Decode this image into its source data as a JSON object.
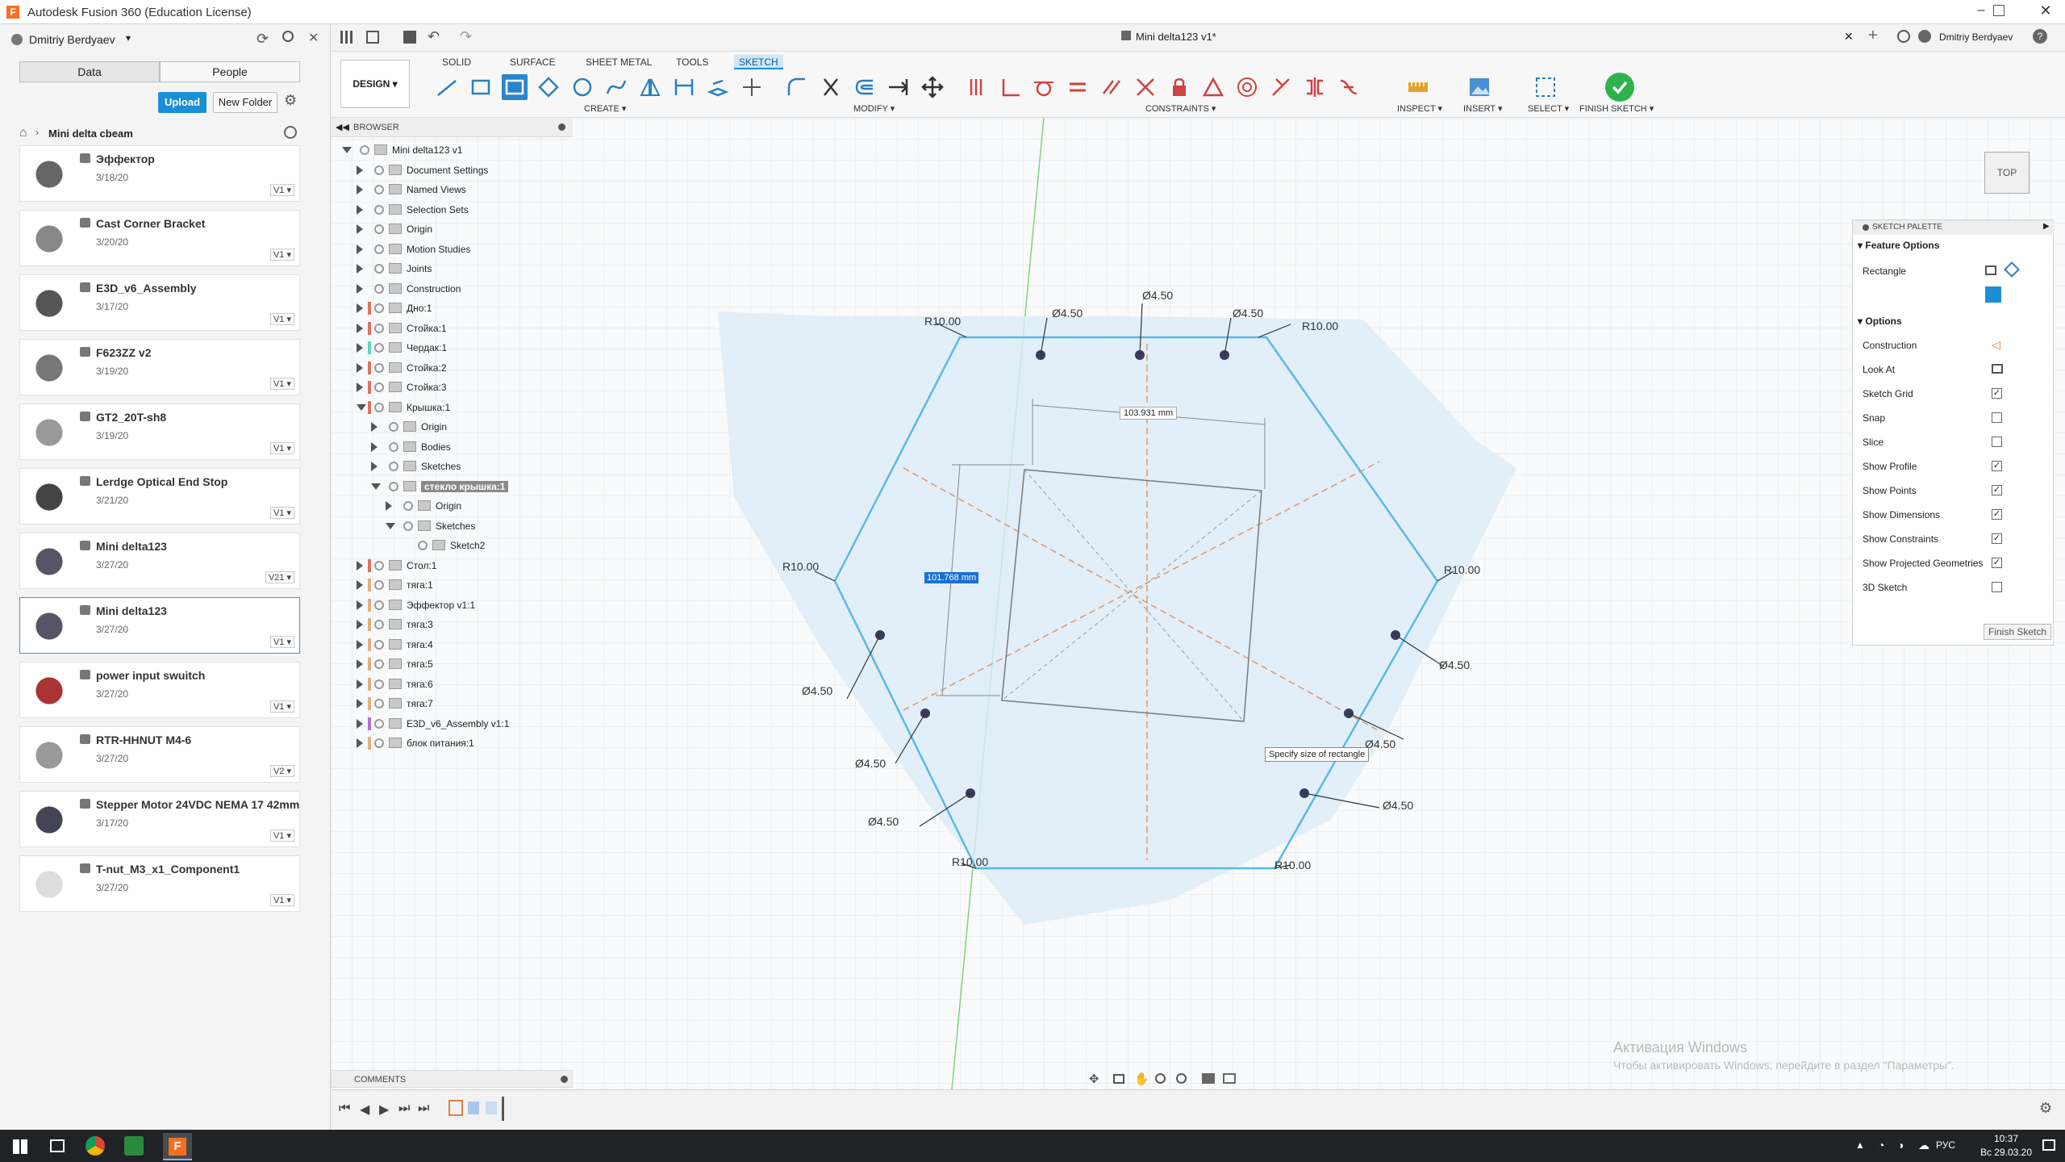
{
  "window": {
    "title": "Autodesk Fusion 360 (Education License)",
    "doc_title": "Mini delta123 v1*",
    "user": "Dmitriy Berdyaev"
  },
  "left": {
    "user": "Dmitriy Berdyaev",
    "tabs": [
      "Data",
      "People"
    ],
    "upload": "Upload",
    "new_folder": "New Folder",
    "project": "Mini delta cbeam",
    "files": [
      {
        "name": "Эффектор",
        "date": "3/18/20",
        "ver": "V1"
      },
      {
        "name": "Cast Corner Bracket",
        "date": "3/20/20",
        "ver": "V1"
      },
      {
        "name": "E3D_v6_Assembly",
        "date": "3/17/20",
        "ver": "V1"
      },
      {
        "name": "F623ZZ v2",
        "date": "3/19/20",
        "ver": "V1"
      },
      {
        "name": "GT2_20T-sh8",
        "date": "3/19/20",
        "ver": "V1"
      },
      {
        "name": "Lerdge Optical End Stop",
        "date": "3/21/20",
        "ver": "V1"
      },
      {
        "name": "Mini delta123",
        "date": "3/27/20",
        "ver": "V21"
      },
      {
        "name": "Mini delta123",
        "date": "3/27/20",
        "ver": "V1"
      },
      {
        "name": "power input swuitch",
        "date": "3/27/20",
        "ver": "V1"
      },
      {
        "name": "RTR-HHNUT M4-6",
        "date": "3/27/20",
        "ver": "V2"
      },
      {
        "name": "Stepper Motor 24VDC NEMA 17 42mm",
        "date": "3/17/20",
        "ver": "V1"
      },
      {
        "name": "T-nut_M3_x1_Component1",
        "date": "3/27/20",
        "ver": "V1"
      }
    ]
  },
  "toolbar": {
    "workspace": "DESIGN",
    "tabs": [
      "SOLID",
      "SURFACE",
      "SHEET METAL",
      "TOOLS",
      "SKETCH"
    ],
    "groups": {
      "create": "CREATE",
      "modify": "MODIFY",
      "constraints": "CONSTRAINTS",
      "inspect": "INSPECT",
      "insert": "INSERT",
      "select": "SELECT",
      "finish": "FINISH SKETCH"
    }
  },
  "browser": {
    "title": "BROWSER",
    "comments": "COMMENTS",
    "items": [
      "Mini delta123 v1",
      "Document Settings",
      "Named Views",
      "Selection Sets",
      "Origin",
      "Motion Studies",
      "Joints",
      "Construction",
      "Дно:1",
      "Стойка:1",
      "Чердак:1",
      "Стойка:2",
      "Стойка:3",
      "Крышка:1",
      "Origin",
      "Bodies",
      "Sketches",
      "стекло крышка:1",
      "Origin",
      "Sketches",
      "Sketch2",
      "Стол:1",
      "тяга:1",
      "Эффектор v1:1",
      "тяга:3",
      "тяга:4",
      "тяга:5",
      "тяга:6",
      "тяга:7",
      "E3D_v6_Assembly v1:1",
      "блок питания:1"
    ]
  },
  "palette": {
    "title": "SKETCH PALETTE",
    "feature_options": "Feature Options",
    "rectangle": "Rectangle",
    "options": "Options",
    "items": [
      {
        "label": "Construction",
        "checked": null
      },
      {
        "label": "Look At",
        "checked": null
      },
      {
        "label": "Sketch Grid",
        "checked": true
      },
      {
        "label": "Snap",
        "checked": false
      },
      {
        "label": "Slice",
        "checked": false
      },
      {
        "label": "Show Profile",
        "checked": true
      },
      {
        "label": "Show Points",
        "checked": true
      },
      {
        "label": "Show Dimensions",
        "checked": true
      },
      {
        "label": "Show Constraints",
        "checked": true
      },
      {
        "label": "Show Projected Geometries",
        "checked": true
      },
      {
        "label": "3D Sketch",
        "checked": false
      }
    ],
    "finish": "Finish Sketch"
  },
  "viewport": {
    "viewcube": "TOP",
    "dim_width": "103.931 mm",
    "dim_height": "101.768 mm",
    "tooltip": "Specify size of rectangle",
    "labels": {
      "d1": "Ø4.50",
      "d2": "Ø4.50",
      "d3": "Ø4.50",
      "d4": "Ø4.50",
      "d5": "Ø4.50",
      "d6": "Ø4.50",
      "d7": "Ø4.50",
      "d8": "Ø4.50",
      "d9": "Ø4.50",
      "r1": "R10.00",
      "r2": "R10.00",
      "r3": "R10.00",
      "r4": "R10.00",
      "r5": "R10.00",
      "r6": "R10.00"
    },
    "watermark1": "Активация Windows",
    "watermark2": "Чтобы активировать Windows, перейдите в раздел \"Параметры\"."
  },
  "taskbar": {
    "time": "10:37",
    "date": "Вс 29.03.20",
    "lang": "РУС"
  },
  "colors": {
    "accent": "#1b8fd6",
    "sketch": "#5bb8e6",
    "green": "#2db34a",
    "profile": "#dcecf8"
  }
}
